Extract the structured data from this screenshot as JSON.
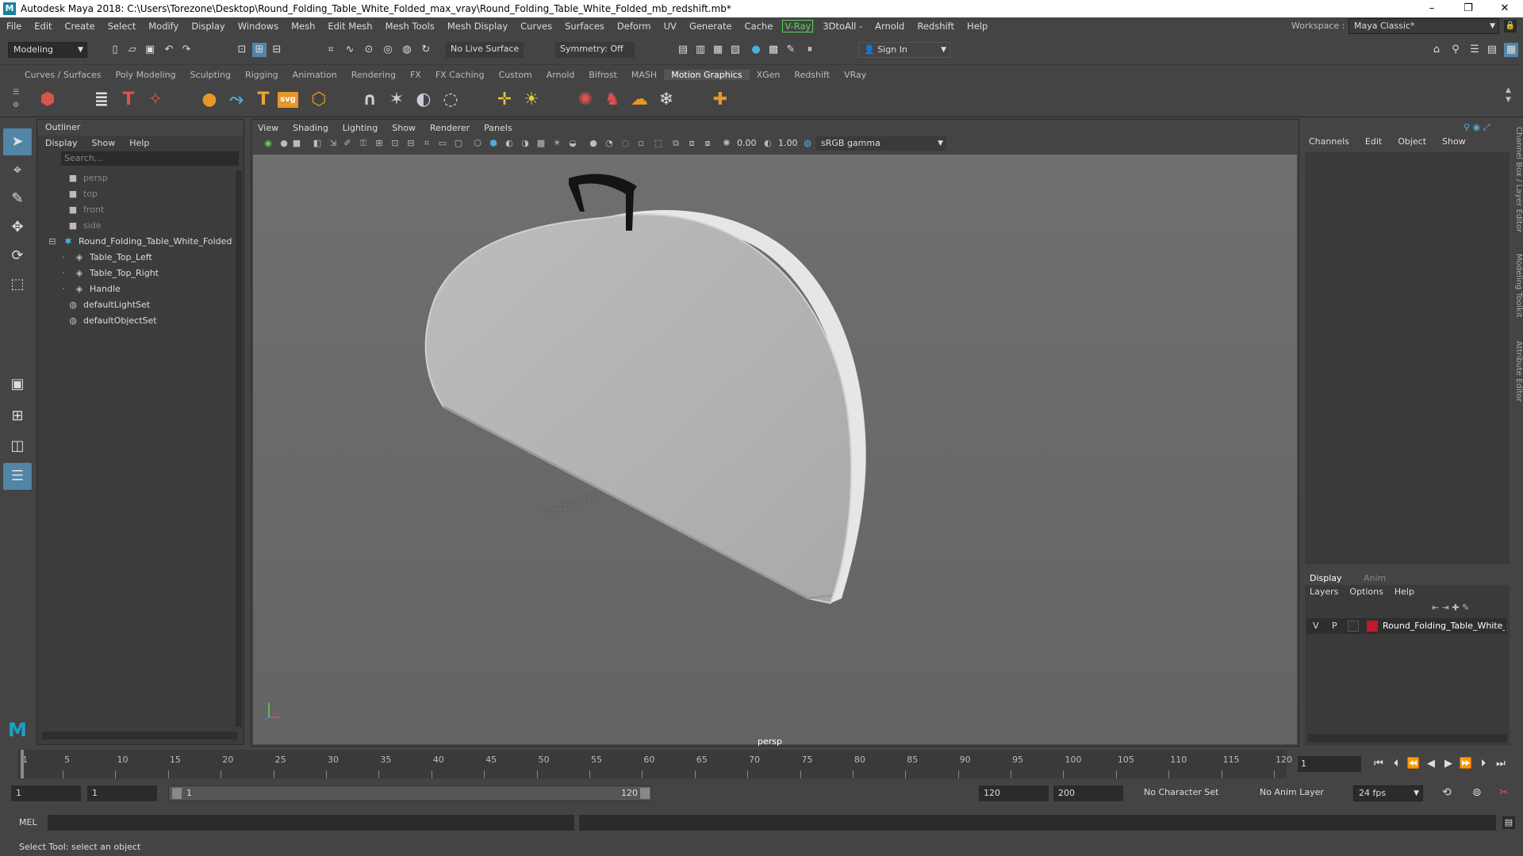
{
  "window": {
    "title": "Autodesk Maya 2018: C:\\Users\\Torezone\\Desktop\\Round_Folding_Table_White_Folded_max_vray\\Round_Folding_Table_White_Folded_mb_redshift.mb*",
    "minimize": "–",
    "restore": "❐",
    "close": "✕"
  },
  "menubar": {
    "items": [
      "File",
      "Edit",
      "Create",
      "Select",
      "Modify",
      "Display",
      "Windows",
      "Mesh",
      "Edit Mesh",
      "Mesh Tools",
      "Mesh Display",
      "Curves",
      "Surfaces",
      "Deform",
      "UV",
      "Generate",
      "Cache"
    ],
    "vray": "V-Ray",
    "items2": [
      "3DtoAll -",
      "Arnold",
      "Redshift",
      "Help"
    ],
    "workspace_label": "Workspace :",
    "workspace_value": "Maya Classic*"
  },
  "statusline": {
    "mode": "Modeling",
    "live_surface": "No Live Surface",
    "symmetry": "Symmetry: Off",
    "sign_in": "Sign In"
  },
  "shelf": {
    "tabs": [
      "Curves / Surfaces",
      "Poly Modeling",
      "Sculpting",
      "Rigging",
      "Animation",
      "Rendering",
      "FX",
      "FX Caching",
      "Custom",
      "Arnold",
      "Bifrost",
      "MASH",
      "Motion Graphics",
      "XGen",
      "Redshift",
      "VRay"
    ],
    "active_tab": "Motion Graphics",
    "svg_label": "svg"
  },
  "outliner": {
    "title": "Outliner",
    "menu": [
      "Display",
      "Show",
      "Help"
    ],
    "search_placeholder": "Search...",
    "items": [
      "persp",
      "top",
      "front",
      "side",
      "Round_Folding_Table_White_Folded",
      "Table_Top_Left",
      "Table_Top_Right",
      "Handle",
      "defaultLightSet",
      "defaultObjectSet"
    ]
  },
  "viewport": {
    "menu": [
      "View",
      "Shading",
      "Lighting",
      "Show",
      "Renderer",
      "Panels"
    ],
    "exposure": "0.00",
    "gamma": "1.00",
    "colorspace": "sRGB gamma",
    "camera": "persp"
  },
  "channelbox": {
    "menu": [
      "Channels",
      "Edit",
      "Object",
      "Show"
    ],
    "layer_tabs": [
      "Display",
      "Anim"
    ],
    "layer_menu": [
      "Layers",
      "Options",
      "Help"
    ],
    "layer": {
      "v": "V",
      "p": "P",
      "name": "Round_Folding_Table_White_I",
      "color": "#c0182e"
    },
    "side_tabs": [
      "Channel Box / Layer Editor",
      "Modeling Toolkit",
      "Attribute Editor"
    ]
  },
  "timeline": {
    "ticks": [
      "1",
      "5",
      "10",
      "15",
      "20",
      "25",
      "30",
      "35",
      "40",
      "45",
      "50",
      "55",
      "60",
      "65",
      "70",
      "75",
      "80",
      "85",
      "90",
      "95",
      "100",
      "105",
      "110",
      "115",
      "120"
    ],
    "current_frame": "1"
  },
  "range": {
    "start": "1",
    "playback_start": "1",
    "slider_start": "1",
    "slider_end": "120",
    "playback_end": "120",
    "end": "200",
    "character_set": "No Character Set",
    "anim_layer": "No Anim Layer",
    "fps": "24 fps"
  },
  "command": {
    "mel": "MEL"
  },
  "help": {
    "text": "Select Tool: select an object"
  }
}
